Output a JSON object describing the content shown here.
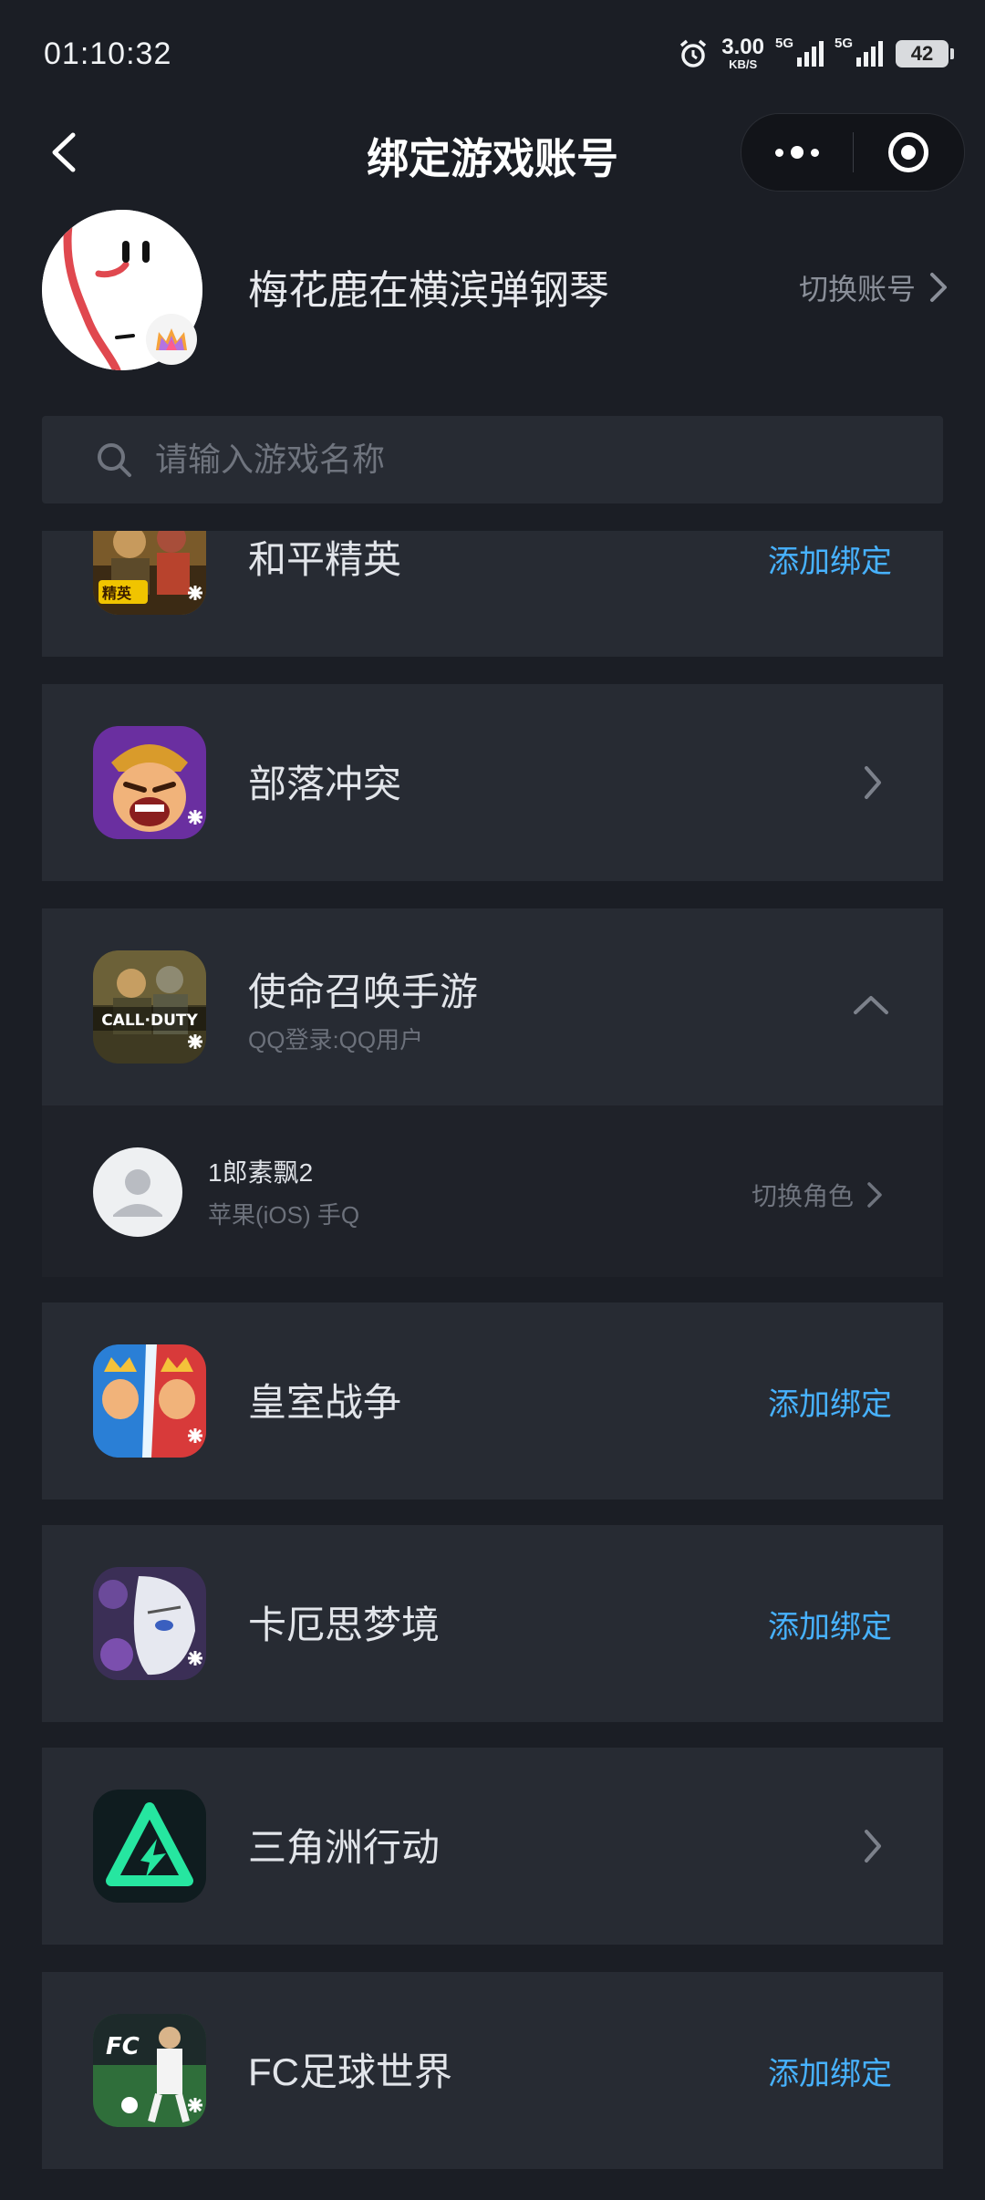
{
  "status_bar": {
    "time": "01:10:32",
    "net_speed_value": "3.00",
    "net_speed_unit": "KB/S",
    "sim1_label": "5G",
    "sim2_label": "5G",
    "battery": "42"
  },
  "nav": {
    "title": "绑定游戏账号"
  },
  "profile": {
    "name": "梅花鹿在横滨弹钢琴",
    "switch_account_label": "切换账号"
  },
  "search": {
    "placeholder": "请输入游戏名称"
  },
  "games": [
    {
      "title": "和平精英",
      "action": "添加绑定",
      "icon": "peacekeeper-elite-icon"
    },
    {
      "title": "部落冲突",
      "action": "",
      "icon": "clash-of-clans-icon"
    },
    {
      "title": "使命召唤手游",
      "subtitle": "QQ登录:QQ用户",
      "icon": "call-of-duty-mobile-icon",
      "role": {
        "name": "1郎素飘2",
        "platform": "苹果(iOS) 手Q",
        "switch_label": "切换角色"
      }
    },
    {
      "title": "皇室战争",
      "action": "添加绑定",
      "icon": "clash-royale-icon"
    },
    {
      "title": "卡厄思梦境",
      "action": "添加绑定",
      "icon": "chaos-zero-nightmare-icon"
    },
    {
      "title": "三角洲行动",
      "action": "",
      "icon": "delta-force-icon"
    },
    {
      "title": "FC足球世界",
      "action": "添加绑定",
      "icon": "fc-football-world-icon"
    }
  ],
  "icon_texts": {
    "cod_logo": "CALL·DUTY",
    "fc_logo": "FC"
  },
  "colors": {
    "background": "#1b1e25",
    "card": "#272b33",
    "link": "#47b2ff"
  }
}
